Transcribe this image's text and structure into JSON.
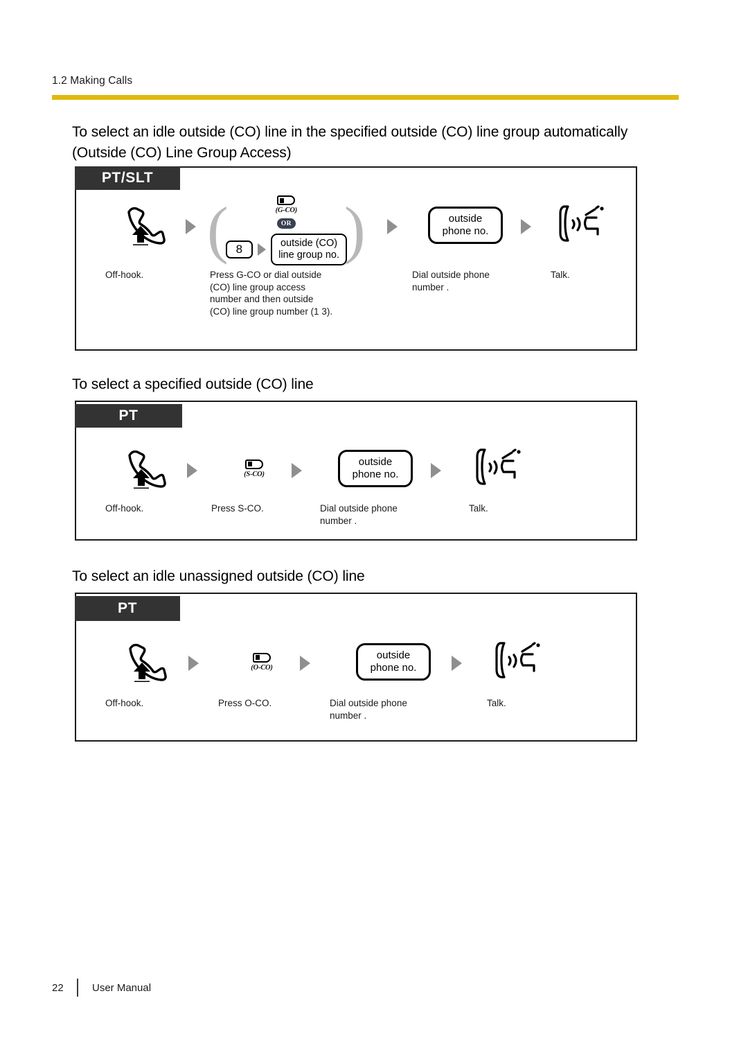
{
  "page": {
    "running_header": "1.2 Making Calls",
    "accent_color": "#E0B90E",
    "tab_color": "#333333",
    "arrow_color": "#8F8F8F"
  },
  "sections": [
    {
      "heading": "To select an idle outside (CO) line in the specified outside (CO) line group automatically (Outside (CO) Line Group Access)",
      "tab_label": "PT/SLT",
      "steps": [
        {
          "icon": "off-hook-handset-icon",
          "caption": "Off-hook."
        },
        {
          "icon": "g-co-button-group",
          "button_label": "(G-CO)",
          "or_label": "OR",
          "keycap": "8",
          "box_text": "outside (CO)\nline group no.",
          "caption": "Press G-CO or dial outside\n(CO) line group access\nnumber  and then outside\n(CO) line group number   (1 3)."
        },
        {
          "icon": "outside-phone-no-box",
          "box_text": "outside\nphone no.",
          "caption": "Dial outside phone\nnumber ."
        },
        {
          "icon": "talk-icon",
          "caption": "Talk."
        }
      ]
    },
    {
      "heading": "To select a specified outside (CO) line",
      "tab_label": "PT",
      "steps": [
        {
          "icon": "off-hook-handset-icon",
          "caption": "Off-hook."
        },
        {
          "icon": "s-co-button-icon",
          "button_label": "(S-CO)",
          "caption": "Press S-CO."
        },
        {
          "icon": "outside-phone-no-box",
          "box_text": "outside\nphone no.",
          "caption": "Dial outside phone\nnumber ."
        },
        {
          "icon": "talk-icon",
          "caption": "Talk."
        }
      ]
    },
    {
      "heading": "To select an idle unassigned outside (CO) line",
      "tab_label": "PT",
      "steps": [
        {
          "icon": "off-hook-handset-icon",
          "caption": "Off-hook."
        },
        {
          "icon": "o-co-button-icon",
          "button_label": "(O-CO)",
          "caption": "Press O-CO."
        },
        {
          "icon": "outside-phone-no-box",
          "box_text": "outside\nphone no.",
          "caption": "Dial outside phone\nnumber ."
        },
        {
          "icon": "talk-icon",
          "caption": "Talk."
        }
      ]
    }
  ],
  "footer": {
    "page_number": "22",
    "document_title": "User Manual"
  }
}
